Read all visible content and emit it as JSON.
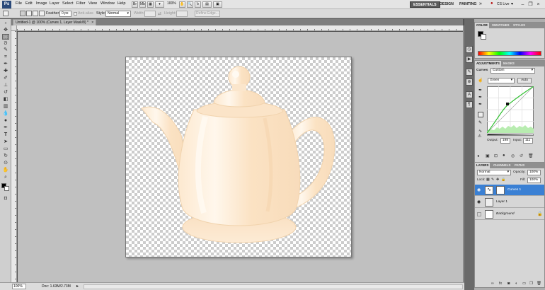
{
  "app": {
    "logo": "Ps"
  },
  "menu": [
    "File",
    "Edit",
    "Image",
    "Layer",
    "Select",
    "Filter",
    "View",
    "Window",
    "Help"
  ],
  "menubar_extra": {
    "zoom": "100%"
  },
  "workspaces": [
    "ESSENTIALS",
    "DESIGN",
    "PAINTING"
  ],
  "cs_live": "CS Live",
  "options": {
    "feather_label": "Feather:",
    "feather_value": "0 px",
    "antialias_label": "Anti-alias",
    "style_label": "Style:",
    "style_value": "Normal",
    "width_label": "Width:",
    "height_label": "Height:",
    "refine_edge": "Refine Edge..."
  },
  "document": {
    "tab_title": "Untitled-1 @ 100% (Curves 1, Layer Mask/8) *"
  },
  "status": {
    "zoom": "100%",
    "doc_info": "Doc: 1.63M/2.73M"
  },
  "color_panel": {
    "tabs": [
      "COLOR",
      "SWATCHES",
      "STYLES"
    ]
  },
  "adjustments": {
    "tabs": [
      "ADJUSTMENTS",
      "MASKS"
    ],
    "preset_label": "Curves",
    "preset_value": "Custom",
    "channel_value": "Green",
    "auto_label": "Auto",
    "output_label": "Output:",
    "output_value": "198",
    "input_label": "Input:",
    "input_value": "111"
  },
  "layers_panel": {
    "tabs": [
      "LAYERS",
      "CHANNELS",
      "PATHS"
    ],
    "blend_mode": "Normal",
    "opacity_label": "Opacity:",
    "opacity_value": "100%",
    "lock_label": "Lock:",
    "fill_label": "Fill:",
    "fill_value": "100%",
    "layers": [
      {
        "name": "Curves 1",
        "selected": true
      },
      {
        "name": "Layer 1",
        "selected": false
      },
      {
        "name": "Background",
        "selected": false
      }
    ]
  },
  "colors": {
    "accent": "#3a80d4",
    "teapot": "#fbe6cc",
    "curve_line": "#2fbf2f"
  }
}
